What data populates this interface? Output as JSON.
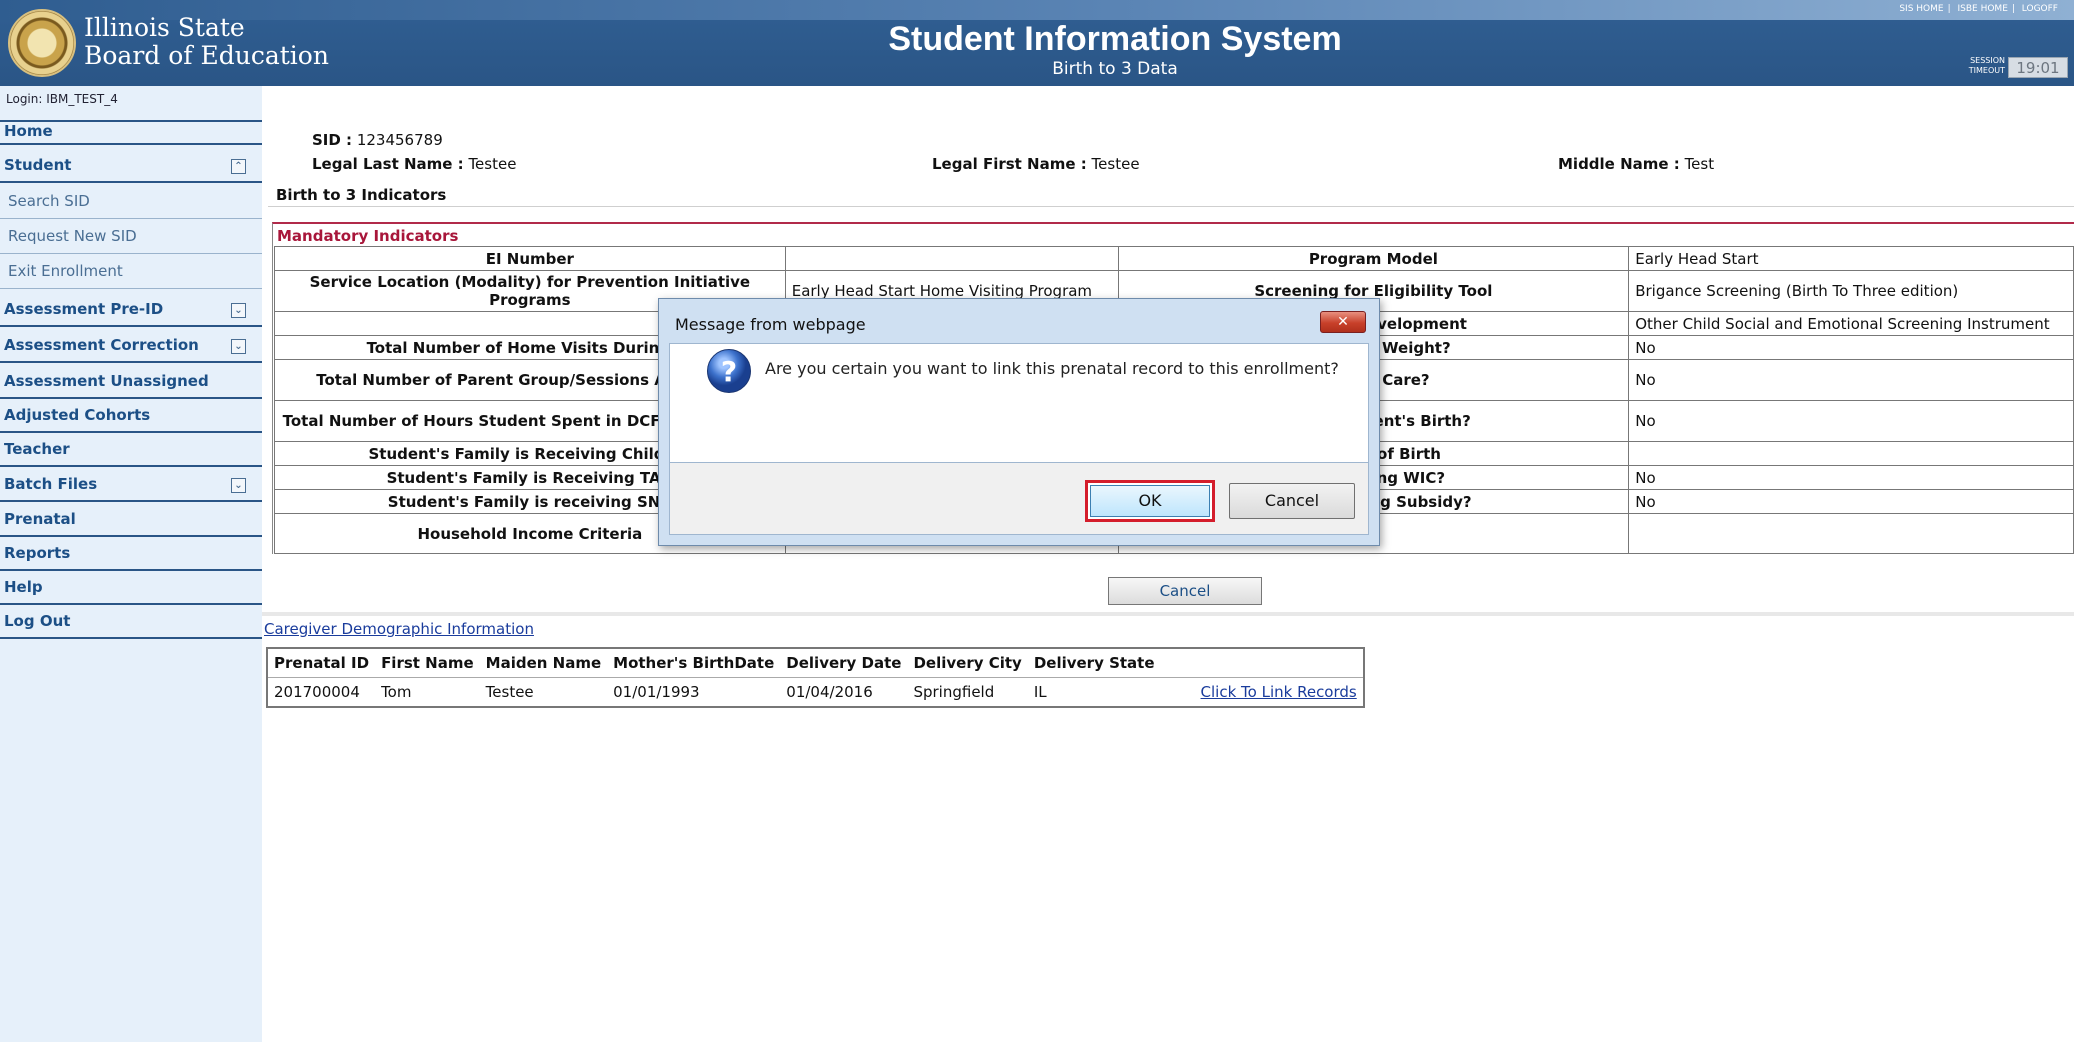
{
  "header": {
    "org_line1": "Illinois State",
    "org_line2": "Board of Education",
    "title": "Student Information System",
    "subtitle": "Birth to 3 Data",
    "links": [
      "SIS HOME",
      "ISBE HOME",
      "LOGOFF"
    ],
    "session_label_1": "SESSION",
    "session_label_2": "TIMEOUT",
    "session_time": "19:01",
    "colors": {
      "header_bg": "#2d5a8c",
      "sidebar_bg": "#e6f0fa",
      "accent_red": "#a8163a"
    }
  },
  "sidebar": {
    "login": "Login: IBM_TEST_4",
    "items": [
      {
        "label": "Home"
      },
      {
        "label": "Student"
      },
      {
        "label": "Search SID"
      },
      {
        "label": "Request New SID"
      },
      {
        "label": "Exit Enrollment"
      },
      {
        "label": "Assessment Pre-ID"
      },
      {
        "label": "Assessment Correction"
      },
      {
        "label": "Assessment Unassigned"
      },
      {
        "label": "Adjusted Cohorts"
      },
      {
        "label": "Teacher"
      },
      {
        "label": "Batch Files"
      },
      {
        "label": "Prenatal"
      },
      {
        "label": "Reports"
      },
      {
        "label": "Help"
      },
      {
        "label": "Log Out"
      }
    ]
  },
  "student": {
    "sid_label": "SID :",
    "sid": "123456789",
    "last_label": "Legal Last Name :",
    "last": "Testee",
    "first_label": "Legal First Name :",
    "first": "Testee",
    "middle_label": "Middle Name :",
    "middle": "Test"
  },
  "birth3": {
    "section_title": "Birth to 3 Indicators",
    "mandatory_title": "Mandatory Indicators",
    "rows": [
      {
        "l1": "EI Number",
        "v1": "",
        "l2": "Program Model",
        "v2": "Early Head Start"
      },
      {
        "l1": "Service Location (Modality) for Prevention Initiative Programs",
        "v1": "Early Head Start Home Visiting Program",
        "l2": "Screening for Eligibility Tool",
        "v2": "Brigance Screening (Birth To Three edition)"
      },
      {
        "l1": "",
        "v1": "",
        "l2": "notional Development",
        "v2": "Other Child Social and Emotional Screening Instrument"
      },
      {
        "l1": "Total Number of Home Visits During th",
        "v1": "",
        "l2": "Low Birth Weight?",
        "v2": "No"
      },
      {
        "l1": "Total Number of Parent Group/Sessions Atten Year",
        "v1": "",
        "l2": "outh in Care?",
        "v2": "No"
      },
      {
        "l1": "Total Number of Hours Student Spent in DCFS Care Center",
        "v1": "",
        "l2": "ime of Student's Birth?",
        "v2": "No"
      },
      {
        "l1": "Student's Family is Receiving Child Su",
        "v1": "",
        "l2": "r's Date of Birth",
        "v2": ""
      },
      {
        "l1": "Student's Family is Receiving TAN",
        "v1": "",
        "l2": "s Receiving WIC?",
        "v2": "No"
      },
      {
        "l1": "Student's Family is receiving SNA",
        "v1": "",
        "l2": "iving Housing Subsidy?",
        "v2": "No"
      },
      {
        "l1": "Household Income Criteria",
        "v1": "",
        "l2": "",
        "v2": ""
      }
    ],
    "cancel_label": "Cancel"
  },
  "caregiver": {
    "link": "Caregiver Demographic Information",
    "columns": [
      "Prenatal ID",
      "First Name",
      "Maiden Name",
      "Mother's BirthDate",
      "Delivery Date",
      "Delivery City",
      "Delivery State",
      ""
    ],
    "rows": [
      {
        "prenatal_id": "201700004",
        "first_name": "Tom",
        "maiden_name": "Testee",
        "mother_birthdate": "01/01/1993",
        "delivery_date": "01/04/2016",
        "delivery_city": "Springfield",
        "delivery_state": "IL",
        "link": "Click To Link Records"
      }
    ]
  },
  "dialog": {
    "title": "Message from webpage",
    "message": "Are you certain you want to link this prenatal record to this enrollment?",
    "ok": "OK",
    "cancel": "Cancel"
  }
}
